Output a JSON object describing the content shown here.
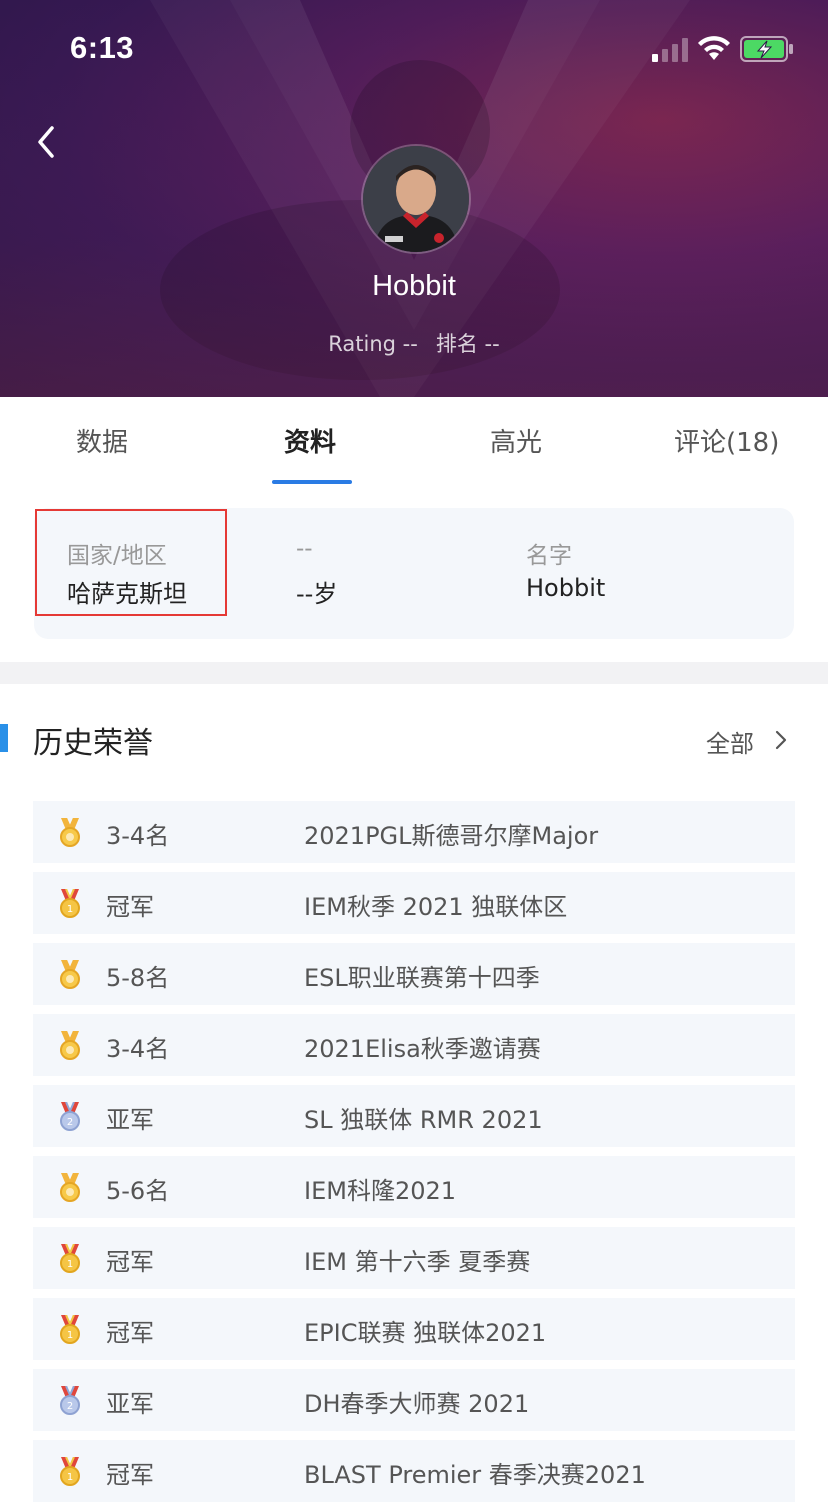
{
  "status_bar": {
    "time": "6:13",
    "signal_icon": "cellular-signal-icon",
    "wifi_icon": "wifi-icon",
    "battery_icon": "battery-charging-icon",
    "battery_color": "#4cd964"
  },
  "header": {
    "player_name": "Hobbit",
    "rating_label": "Rating --",
    "rank_label": "排名 --"
  },
  "tabs": [
    {
      "label": "数据",
      "active": false
    },
    {
      "label": "资料",
      "active": true
    },
    {
      "label": "高光",
      "active": false
    },
    {
      "label": "评论(18)",
      "active": false
    }
  ],
  "accent_color": "#2a7be4",
  "info": [
    {
      "label": "国家/地区",
      "value": "哈萨克斯坦"
    },
    {
      "label": "--",
      "value": "--岁"
    },
    {
      "label": "名字",
      "value": "Hobbit"
    }
  ],
  "honors": {
    "title": "历史荣誉",
    "see_all": "全部",
    "items": [
      {
        "medal": "bronze-medal-icon",
        "rank": "3-4名",
        "event": "2021PGL斯德哥尔摩Major"
      },
      {
        "medal": "gold-medal-icon",
        "rank": "冠军",
        "event": "IEM秋季 2021 独联体区"
      },
      {
        "medal": "bronze-medal-icon",
        "rank": "5-8名",
        "event": "ESL职业联赛第十四季"
      },
      {
        "medal": "bronze-medal-icon",
        "rank": "3-4名",
        "event": "2021Elisa秋季邀请赛"
      },
      {
        "medal": "silver-medal-icon",
        "rank": "亚军",
        "event": "SL 独联体 RMR 2021"
      },
      {
        "medal": "bronze-medal-icon",
        "rank": "5-6名",
        "event": "IEM科隆2021"
      },
      {
        "medal": "gold-medal-icon",
        "rank": "冠军",
        "event": "IEM 第十六季 夏季赛"
      },
      {
        "medal": "gold-medal-icon",
        "rank": "冠军",
        "event": "EPIC联赛 独联体2021"
      },
      {
        "medal": "silver-medal-icon",
        "rank": "亚军",
        "event": "DH春季大师赛 2021"
      },
      {
        "medal": "gold-medal-icon",
        "rank": "冠军",
        "event": "BLAST Premier 春季决赛2021"
      }
    ]
  }
}
